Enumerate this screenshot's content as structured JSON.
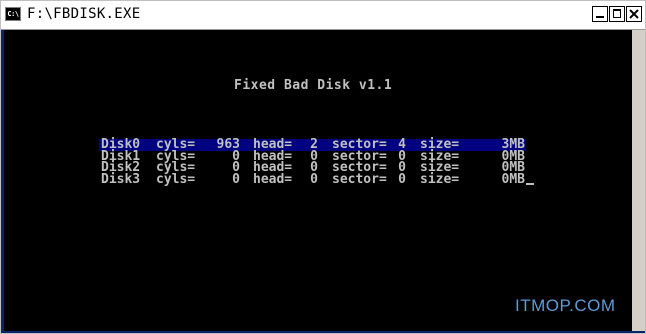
{
  "window": {
    "title": "F:\\FBDISK.EXE",
    "icon_text": "C:\\"
  },
  "console": {
    "heading": "Fixed Bad Disk v1.1",
    "labels": {
      "cyls": "cyls=",
      "head": "head=",
      "sector": "sector=",
      "size": "size="
    },
    "disks": [
      {
        "name": "Disk0",
        "cyls": "963",
        "head": "2",
        "sector": "4",
        "size": "3MB",
        "selected": true
      },
      {
        "name": "Disk1",
        "cyls": "0",
        "head": "0",
        "sector": "0",
        "size": "0MB",
        "selected": false
      },
      {
        "name": "Disk2",
        "cyls": "0",
        "head": "0",
        "sector": "0",
        "size": "0MB",
        "selected": false
      },
      {
        "name": "Disk3",
        "cyls": "0",
        "head": "0",
        "sector": "0",
        "size": "0MB",
        "selected": false
      }
    ]
  },
  "watermark": "ITMOP.COM",
  "colors": {
    "console_background": "#000000",
    "console_text": "#c0c0c0",
    "selection": "#000080",
    "watermark": "#5f9ad6"
  }
}
